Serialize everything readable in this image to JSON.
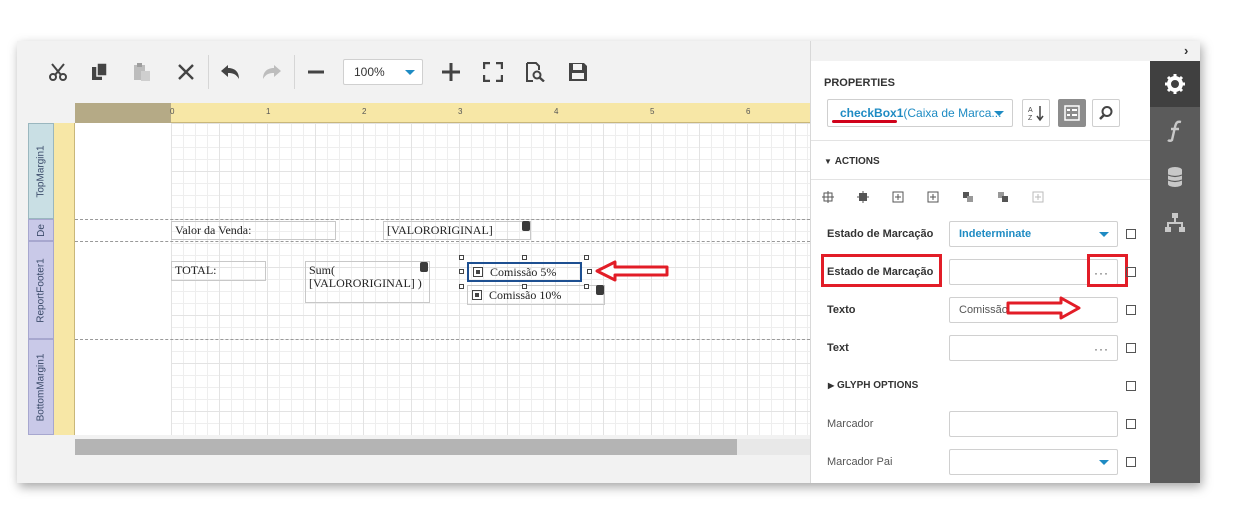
{
  "toolbar": {
    "zoom_value": "100%",
    "icons": [
      "cut-icon",
      "copy-icon",
      "paste-icon",
      "delete-icon",
      "undo-icon",
      "redo-icon",
      "zoom-out-icon",
      "zoom-in-icon",
      "fit-icon",
      "preview-icon",
      "save-icon"
    ]
  },
  "ruler": {
    "numbers": [
      "0",
      "1",
      "2",
      "3",
      "4",
      "5",
      "6"
    ]
  },
  "bands": {
    "top_margin": "TopMargin1",
    "detail": "De",
    "report_footer": "ReportFooter1",
    "bottom_margin": "BottomMargin1"
  },
  "design": {
    "valor_label": "Valor da Venda:",
    "valor_field": "[VALORORIGINAL]",
    "total_label": "TOTAL:",
    "sum_line1": "Sum(",
    "sum_line2": "[VALORORIGINAL] )",
    "checkbox1": "Comissão 5%",
    "checkbox2": "Comissão 10%"
  },
  "properties": {
    "title": "PROPERTIES",
    "object_name": "checkBox1",
    "object_type": " (Caixa de Marca...",
    "actions_header": "ACTIONS",
    "glyph_header": "GLYPH OPTIONS",
    "rows": {
      "estado1_label": "Estado de Marcação",
      "estado1_value": "Indeterminate",
      "estado2_label": "Estado de Marcação",
      "estado2_dots": "···",
      "texto_label": "Texto",
      "texto_value": "Comissão 5%",
      "text_label": "Text",
      "text_dots": "···",
      "marcador_label": "Marcador",
      "marcador_pai_label": "Marcador Pai"
    }
  },
  "tabs": [
    "gear-icon",
    "function-icon",
    "database-icon",
    "hierarchy-icon"
  ],
  "colors": {
    "accent": "#1e8bc3",
    "highlight_red": "#e21d27",
    "tab_strip": "#5b5b5b"
  }
}
